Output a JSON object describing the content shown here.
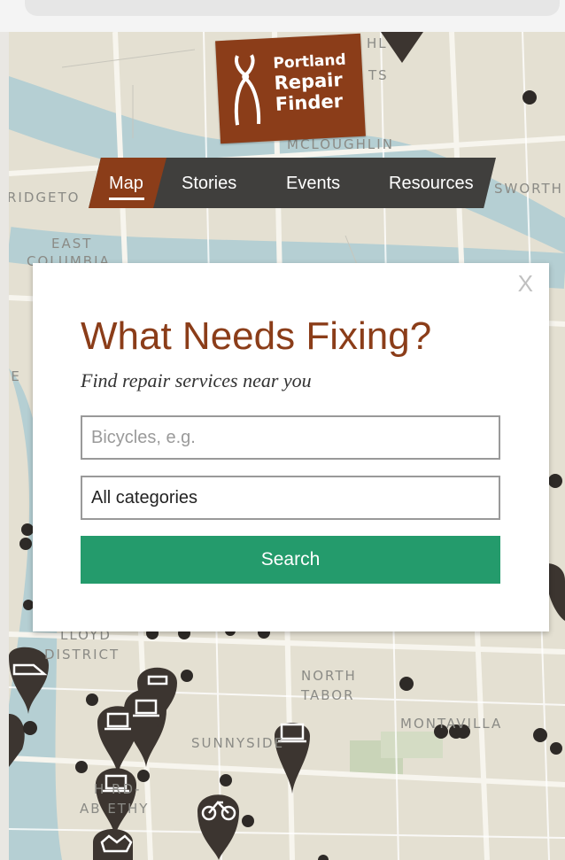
{
  "logo": {
    "line1": "Portland",
    "line2": "Repair",
    "line3": "Finder"
  },
  "nav": {
    "items": [
      {
        "label": "Map"
      },
      {
        "label": "Stories"
      },
      {
        "label": "Events"
      },
      {
        "label": "Resources"
      }
    ],
    "active": "Map"
  },
  "map_labels": {
    "mcloughlin": "MCLOUGHLIN",
    "ridgeto": "RIDGETO",
    "sworth": "SWORTH",
    "east": "EAST",
    "columbia": "COLUMBIA",
    "ie": "IE",
    "lloyd": "LLOYD",
    "district": "DISTRICT",
    "north": "NORTH",
    "tabor": "TABOR",
    "montavilla": "MONTAVILLA",
    "sunnyside": "SUNNYSIDE",
    "hrd": "H    RD-",
    "abethy": "AB    ETHY",
    "hl": "HL",
    "ts": "TS"
  },
  "modal": {
    "close_label": "X",
    "title": "What Needs Fixing?",
    "subtitle": "Find repair services near you",
    "search_placeholder": "Bicycles, e.g.",
    "category_value": "All categories",
    "search_button": "Search"
  },
  "icons": [
    "tool-logo-icon",
    "laptop-icon",
    "bike-icon",
    "shoe-icon",
    "shirt-icon",
    "map-pin-icon"
  ],
  "colors": {
    "brand": "#8b3d19",
    "nav": "#403f3d",
    "search_button": "#249b6c",
    "pin": "#3c3530"
  }
}
